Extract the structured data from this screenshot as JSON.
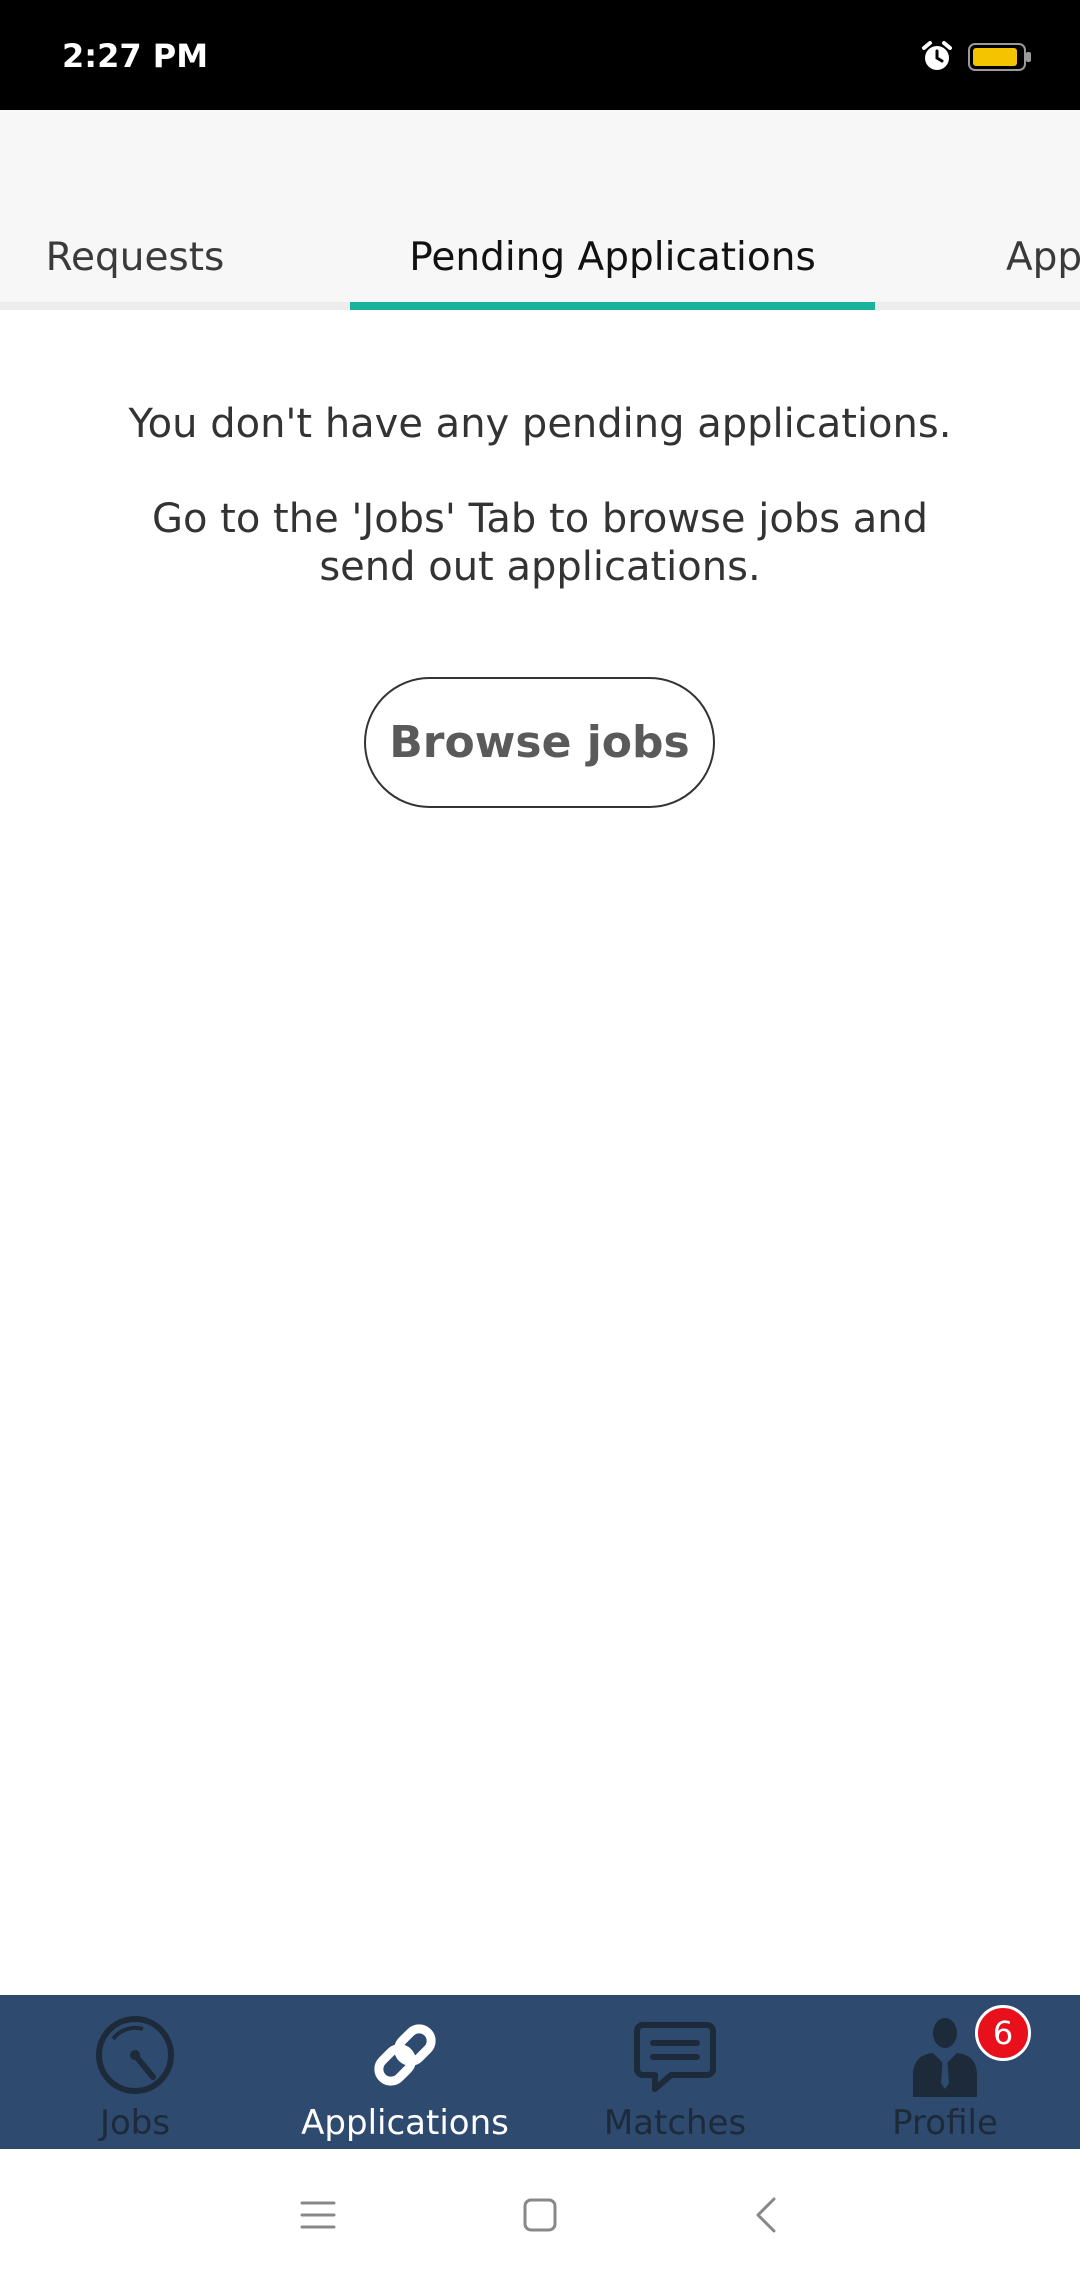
{
  "status_bar": {
    "time": "2:27 PM",
    "icons": [
      "alarm-icon",
      "battery-icon"
    ],
    "battery_color": "#f5c400"
  },
  "tabs": {
    "items": [
      {
        "label": "Requests",
        "active": false
      },
      {
        "label": "Pending Applications",
        "active": true
      },
      {
        "label": "Appl",
        "active": false
      }
    ],
    "indicator_color": "#1ab29b"
  },
  "empty_state": {
    "line1": "You don't have any pending applications.",
    "line2": "Go to the 'Jobs' Tab to browse jobs and send out applications.",
    "button_label": "Browse jobs"
  },
  "bottom_nav": {
    "background": "#2e4a6e",
    "items": [
      {
        "label": "Jobs",
        "icon": "radar-icon",
        "active": false
      },
      {
        "label": "Applications",
        "icon": "link-icon",
        "active": true
      },
      {
        "label": "Matches",
        "icon": "chat-bubble-icon",
        "active": false
      },
      {
        "label": "Profile",
        "icon": "person-icon",
        "active": false,
        "badge": "6"
      }
    ]
  },
  "system_nav": {
    "icons": [
      "menu-icon",
      "home-icon",
      "back-icon"
    ]
  }
}
